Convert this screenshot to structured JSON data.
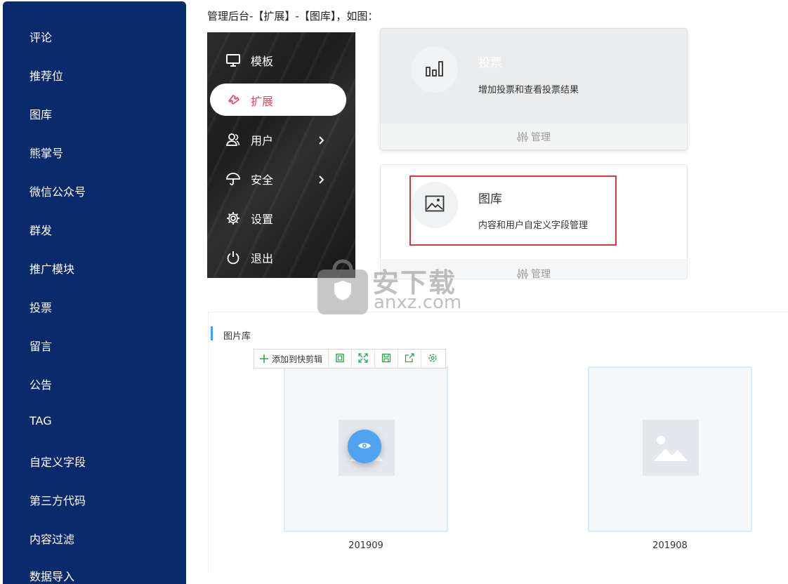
{
  "sidebar": {
    "items": [
      "评论",
      "推荐位",
      "图库",
      "熊掌号",
      "微信公众号",
      "群发",
      "推广模块",
      "投票",
      "留言",
      "公告",
      "TAG",
      "自定义字段",
      "第三方代码",
      "内容过滤",
      "数据导入"
    ]
  },
  "caption": "管理后台-【扩展】-【图库】，如图：",
  "menu": {
    "items": [
      {
        "label": "模板",
        "icon": "monitor-icon"
      },
      {
        "label": "扩展",
        "icon": "puzzle-icon",
        "active": true
      },
      {
        "label": "用户",
        "icon": "users-icon",
        "arrow": true
      },
      {
        "label": "安全",
        "icon": "umbrella-icon",
        "arrow": true
      },
      {
        "label": "设置",
        "icon": "gear-icon"
      },
      {
        "label": "退出",
        "icon": "power-icon"
      }
    ],
    "active_color": "#e0485f"
  },
  "cards": [
    {
      "title": "投票",
      "desc": "增加投票和查看投票结果",
      "footer": "管理",
      "icon": "bar-chart-icon"
    },
    {
      "title": "图库",
      "desc": "内容和用户自定义字段管理",
      "footer": "管理",
      "icon": "image-icon"
    }
  ],
  "highlight_color": "#d33a3a",
  "library": {
    "title": "图片库",
    "toolbar": {
      "add_label": "添加到快剪辑",
      "buttons": [
        "crop-icon",
        "expand-icon",
        "save-icon",
        "share-icon",
        "settings-icon"
      ]
    },
    "albums": [
      "201909",
      "201908"
    ],
    "accent": "#3aa0ff"
  },
  "watermark": {
    "brand": "安下载",
    "domain": "anxz.com"
  }
}
